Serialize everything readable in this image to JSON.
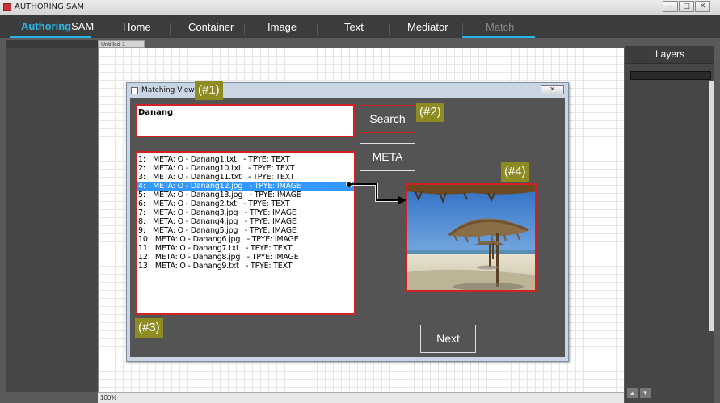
{
  "window": {
    "title": "AUTHORING SAM",
    "minimize_label": "–",
    "maximize_label": "□",
    "close_label": "✕"
  },
  "menu": {
    "brand_part1": "Authoring",
    "brand_part2": "SAM",
    "items": [
      "Home",
      "Container",
      "Image",
      "Text",
      "Mediator",
      "Match"
    ],
    "active_item": "Match"
  },
  "document": {
    "tab_label": "Untitled-1",
    "zoom": "100%"
  },
  "layers_panel": {
    "title": "Layers",
    "up_arrow": "▲",
    "down_arrow": "▼"
  },
  "dialog": {
    "title": "Matching View",
    "close_label": "✕",
    "query_text": "Danang",
    "search_button": "Search",
    "meta_button": "META",
    "next_button": "Next",
    "selected_index": 3,
    "results": [
      {
        "num": "1:",
        "text": "META: O - Danang1.txt   - TPYE: TEXT"
      },
      {
        "num": "2:",
        "text": "META: O - Danang10.txt   - TPYE: TEXT"
      },
      {
        "num": "3:",
        "text": "META: O - Danang11.txt   - TPYE: TEXT"
      },
      {
        "num": "4:",
        "text": "META: O - Danang12.jpg   - TPYE: IMAGE"
      },
      {
        "num": "5:",
        "text": "META: O - Danang13.jpg   - TPYE: IMAGE"
      },
      {
        "num": "6:",
        "text": "META: O - Danang2.txt   - TPYE: TEXT"
      },
      {
        "num": "7:",
        "text": "META: O - Danang3.jpg   - TPYE: IMAGE"
      },
      {
        "num": "8:",
        "text": "META: O - Danang4.jpg   - TPYE: IMAGE"
      },
      {
        "num": "9:",
        "text": "META: O - Danang5.jpg   - TPYE: IMAGE"
      },
      {
        "num": "10:",
        "text": " META: O - Danang6.jpg   - TPYE: IMAGE"
      },
      {
        "num": "11:",
        "text": " META: O - Danang7.txt   - TPYE: TEXT"
      },
      {
        "num": "12:",
        "text": " META: O - Danang8.jpg   - TPYE: IMAGE"
      },
      {
        "num": "13:",
        "text": " META: O - Danang9.txt   - TPYE: TEXT"
      }
    ]
  },
  "annotations": {
    "tag1": "(#1)",
    "tag2": "(#2)",
    "tag3": "(#3)",
    "tag4": "(#4)"
  },
  "colors": {
    "accent": "#2ab6e6",
    "highlight_border": "#cf2323",
    "tag_bg": "#8d8b21",
    "selection": "#3399ff"
  }
}
